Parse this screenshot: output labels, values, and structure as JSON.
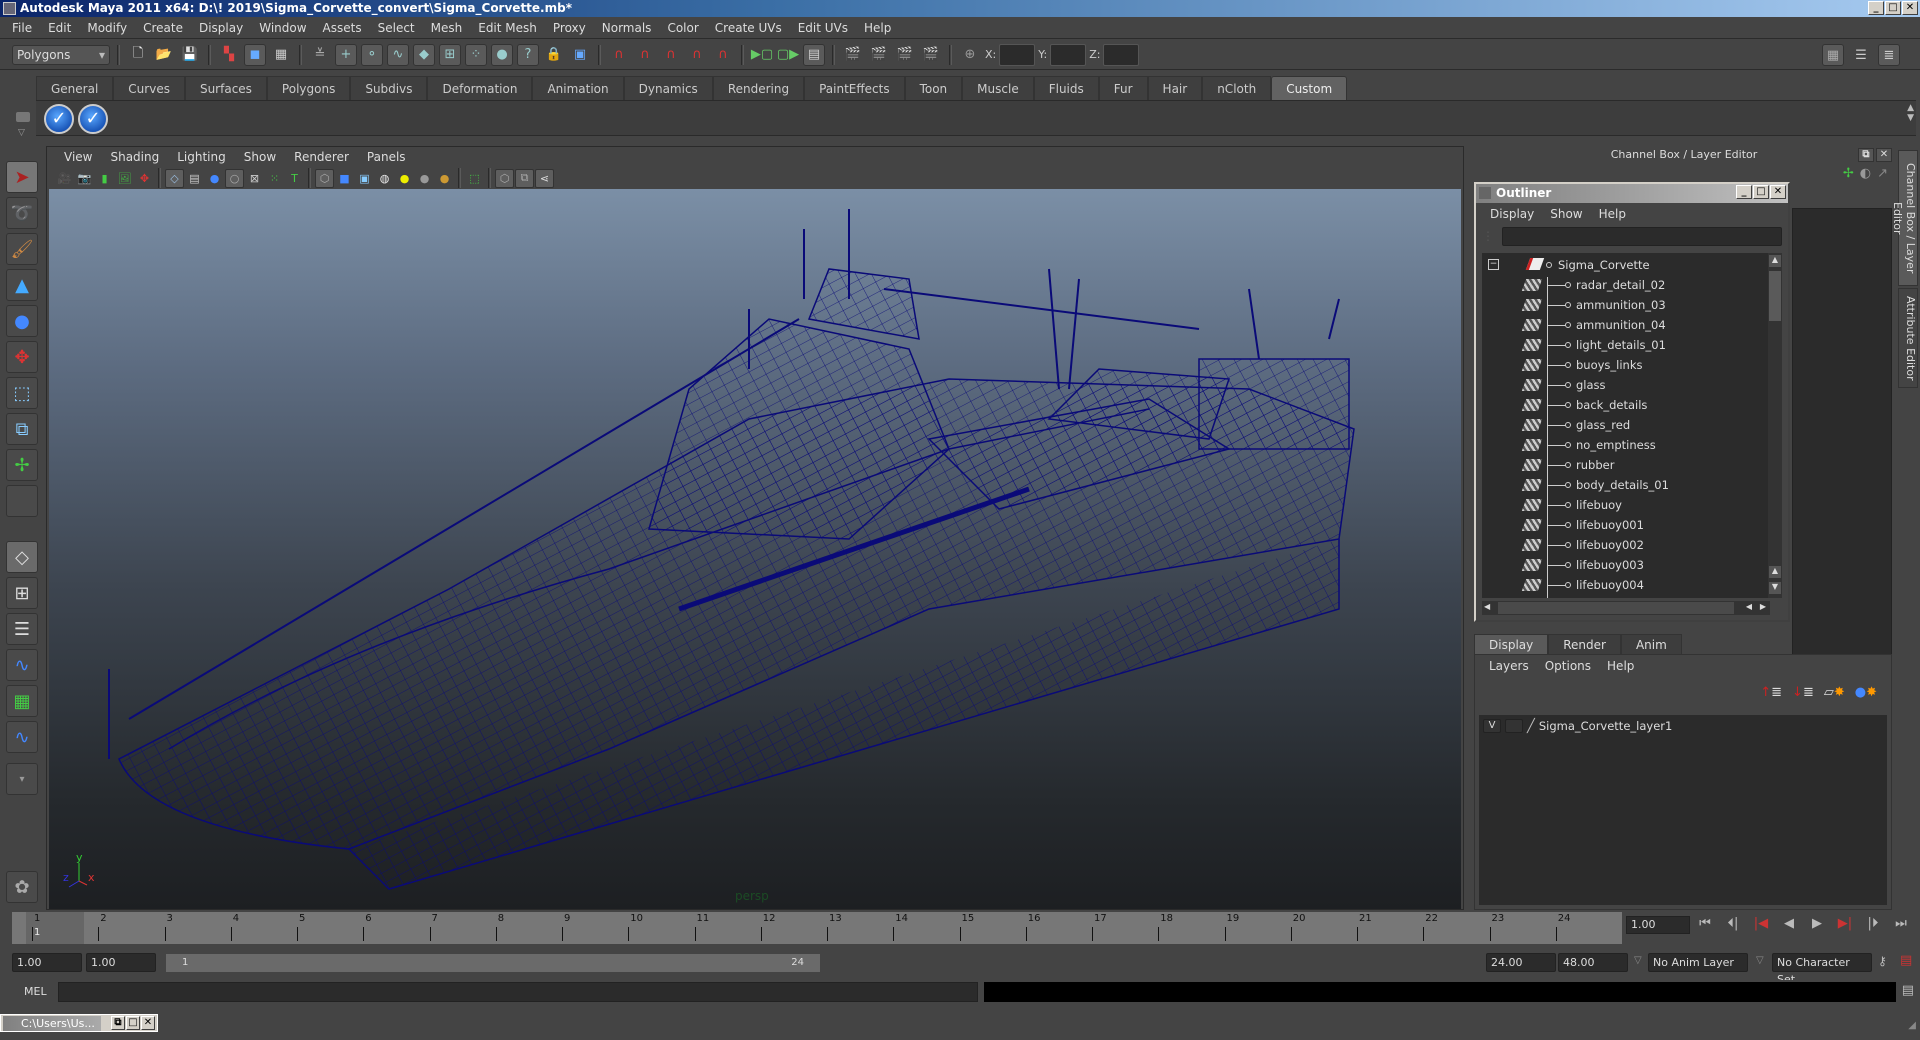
{
  "window": {
    "title": "Autodesk Maya 2011 x64: D:\\! 2019\\Sigma_Corvette_convert\\Sigma_Corvette.mb*",
    "buttons": [
      "minimize",
      "maximize",
      "close"
    ]
  },
  "menubar": [
    "File",
    "Edit",
    "Modify",
    "Create",
    "Display",
    "Window",
    "Assets",
    "Select",
    "Mesh",
    "Edit Mesh",
    "Proxy",
    "Normals",
    "Color",
    "Create UVs",
    "Edit UVs",
    "Help"
  ],
  "statusline": {
    "mode": "Polygons",
    "x_label": "X:",
    "y_label": "Y:",
    "z_label": "Z:"
  },
  "shelf": {
    "tabs": [
      "General",
      "Curves",
      "Surfaces",
      "Polygons",
      "Subdivs",
      "Deformation",
      "Animation",
      "Dynamics",
      "Rendering",
      "PaintEffects",
      "Toon",
      "Muscle",
      "Fluids",
      "Fur",
      "Hair",
      "nCloth",
      "Custom"
    ],
    "active_tab": "Custom",
    "buttons": [
      "checkmark-icon",
      "checkmark-icon"
    ]
  },
  "viewport": {
    "menu": [
      "View",
      "Shading",
      "Lighting",
      "Show",
      "Renderer",
      "Panels"
    ],
    "camera_label": "persp",
    "axis": {
      "x": "x",
      "y": "y",
      "z": "z"
    },
    "wireframe_color": "#0a0a6e"
  },
  "channel_box": {
    "header": "Channel Box / Layer Editor"
  },
  "outliner": {
    "title": "Outliner",
    "menu": [
      "Display",
      "Show",
      "Help"
    ],
    "root": "Sigma_Corvette",
    "items": [
      "radar_detail_02",
      "ammunition_03",
      "ammunition_04",
      "light_details_01",
      "buoys_links",
      "glass",
      "back_details",
      "glass_red",
      "no_emptiness",
      "rubber",
      "body_details_01",
      "lifebuoy",
      "lifebuoy001",
      "lifebuoy002",
      "lifebuoy003",
      "lifebuoy004"
    ]
  },
  "layer_editor": {
    "tabs": [
      "Display",
      "Render",
      "Anim"
    ],
    "active_tab": "Display",
    "menu": [
      "Layers",
      "Options",
      "Help"
    ],
    "layers": [
      {
        "visible": "V",
        "name": "Sigma_Corvette_layer1"
      }
    ]
  },
  "side_tabs": [
    "Channel Box / Layer Editor",
    "Attribute Editor"
  ],
  "timeline": {
    "frames": [
      "1",
      "2",
      "3",
      "4",
      "5",
      "6",
      "7",
      "8",
      "9",
      "10",
      "11",
      "12",
      "13",
      "14",
      "15",
      "16",
      "17",
      "18",
      "19",
      "20",
      "21",
      "22",
      "23",
      "24"
    ],
    "current_frame_marker": "1",
    "current_time": "1.00"
  },
  "range": {
    "start_time": "1.00",
    "playback_start": "1.00",
    "slider_start": "1",
    "slider_end": "24",
    "playback_end": "24.00",
    "end_time": "48.00",
    "anim_layer": "No Anim Layer",
    "character_set": "No Character Set"
  },
  "command_line": {
    "label": "MEL",
    "value": "",
    "result": ""
  },
  "taskbar": {
    "minimized_window": "C:\\Users\\Us..."
  }
}
